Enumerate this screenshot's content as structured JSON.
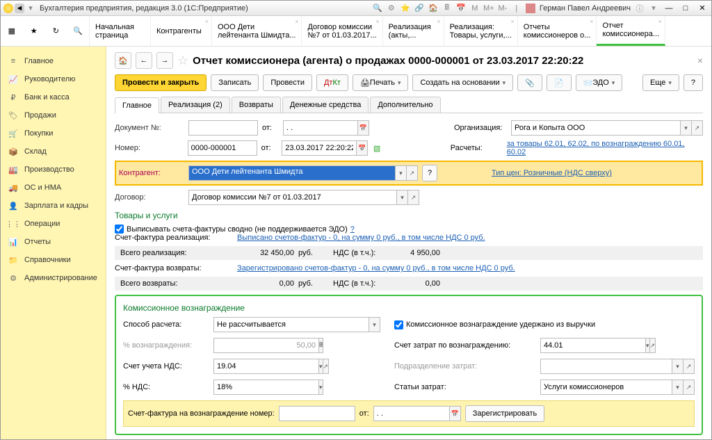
{
  "window_title": "Бухгалтерия предприятия, редакция 3.0  (1С:Предприятие)",
  "user": "Герман Павел Андреевич",
  "tabs": [
    {
      "l1": "Начальная",
      "l2": "страница"
    },
    {
      "l1": "Контрагенты",
      "l2": ""
    },
    {
      "l1": "ООО Дети",
      "l2": "лейтенанта Шмидта..."
    },
    {
      "l1": "Договор комиссии",
      "l2": "№7 от 01.03.2017..."
    },
    {
      "l1": "Реализация",
      "l2": "(акты,..."
    },
    {
      "l1": "Реализация:",
      "l2": "Товары, услуги,..."
    },
    {
      "l1": "Отчеты",
      "l2": "комиссионеров о..."
    },
    {
      "l1": "Отчет",
      "l2": "комиссионера..."
    }
  ],
  "sidebar": [
    "Главное",
    "Руководителю",
    "Банк и касса",
    "Продажи",
    "Покупки",
    "Склад",
    "Производство",
    "ОС и НМА",
    "Зарплата и кадры",
    "Операции",
    "Отчеты",
    "Справочники",
    "Администрирование"
  ],
  "doc_title": "Отчет комиссионера (агента) о продажах 0000-000001 от 23.03.2017 22:20:22",
  "toolbar": {
    "post_close": "Провести и закрыть",
    "save": "Записать",
    "post": "Провести",
    "print": "Печать",
    "create_based": "Создать на основании",
    "edo": "ЭДО",
    "more": "Еще",
    "help": "?"
  },
  "subtabs": [
    "Главное",
    "Реализация (2)",
    "Возвраты",
    "Денежные средства",
    "Дополнительно"
  ],
  "labels": {
    "doc_no": "Документ №:",
    "from": "от:",
    "number": "Номер:",
    "org": "Организация:",
    "settlements": "Расчеты:",
    "counterparty": "Контрагент:",
    "price_type": "Тип цен: Розничные (НДС сверху)",
    "contract": "Договор:"
  },
  "fields": {
    "doc_no": "",
    "date1": ". .",
    "number": "0000-000001",
    "date2": "23.03.2017 22:20:22",
    "org": "Рога и Копыта ООО",
    "settle_link": "за товары 62.01, 62.02, по вознаграждению 60.01, 60.02",
    "counterparty": "ООО Дети лейтенанта Шмидта",
    "contract": "Договор комиссии №7 от 01.03.2017"
  },
  "goods": {
    "title": "Товары и услуги",
    "chk": "Выписывать счета-фактуры сводно (не поддерживается ЭДО)  ",
    "sf_real_label": "Счет-фактура реализация:",
    "sf_real_link": "Выписано счетов-фактур - 0, на сумму 0 руб., в том числе НДС 0 руб.",
    "tot_real": "Всего реализация:",
    "real_sum": "32 450,00",
    "cur": "руб.",
    "vat_lbl": "НДС (в т.ч.):",
    "real_vat": "4 950,00",
    "sf_ret_label": "Счет-фактура возвраты:",
    "sf_ret_link": "Зарегистрировано счетов-фактур - 0, на сумму 0 руб., в том числе НДС 0 руб.",
    "tot_ret": "Всего возвраты:",
    "ret_sum": "0,00",
    "ret_vat": "0,00"
  },
  "comm": {
    "title": "Комиссионное вознаграждение",
    "method_lbl": "Способ расчета:",
    "method": "Не рассчитывается",
    "chk": "Комиссионное вознаграждение удержано из выручки",
    "pct_lbl": "% вознаграждения:",
    "pct": "50,00",
    "cost_acc_lbl": "Счет затрат по вознаграждению:",
    "cost_acc": "44.01",
    "vat_acc_lbl": "Счет учета НДС:",
    "vat_acc": "19.04",
    "dept_lbl": "Подразделение затрат:",
    "vat_pct_lbl": "% НДС:",
    "vat_pct": "18%",
    "cost_item_lbl": "Статьи затрат:",
    "cost_item": "Услуги комиссионеров",
    "sf_lbl": "Счет-фактура на вознаграждение номер:",
    "sf_from": "от:",
    "sf_date": ". .",
    "register": "Зарегистрировать"
  }
}
